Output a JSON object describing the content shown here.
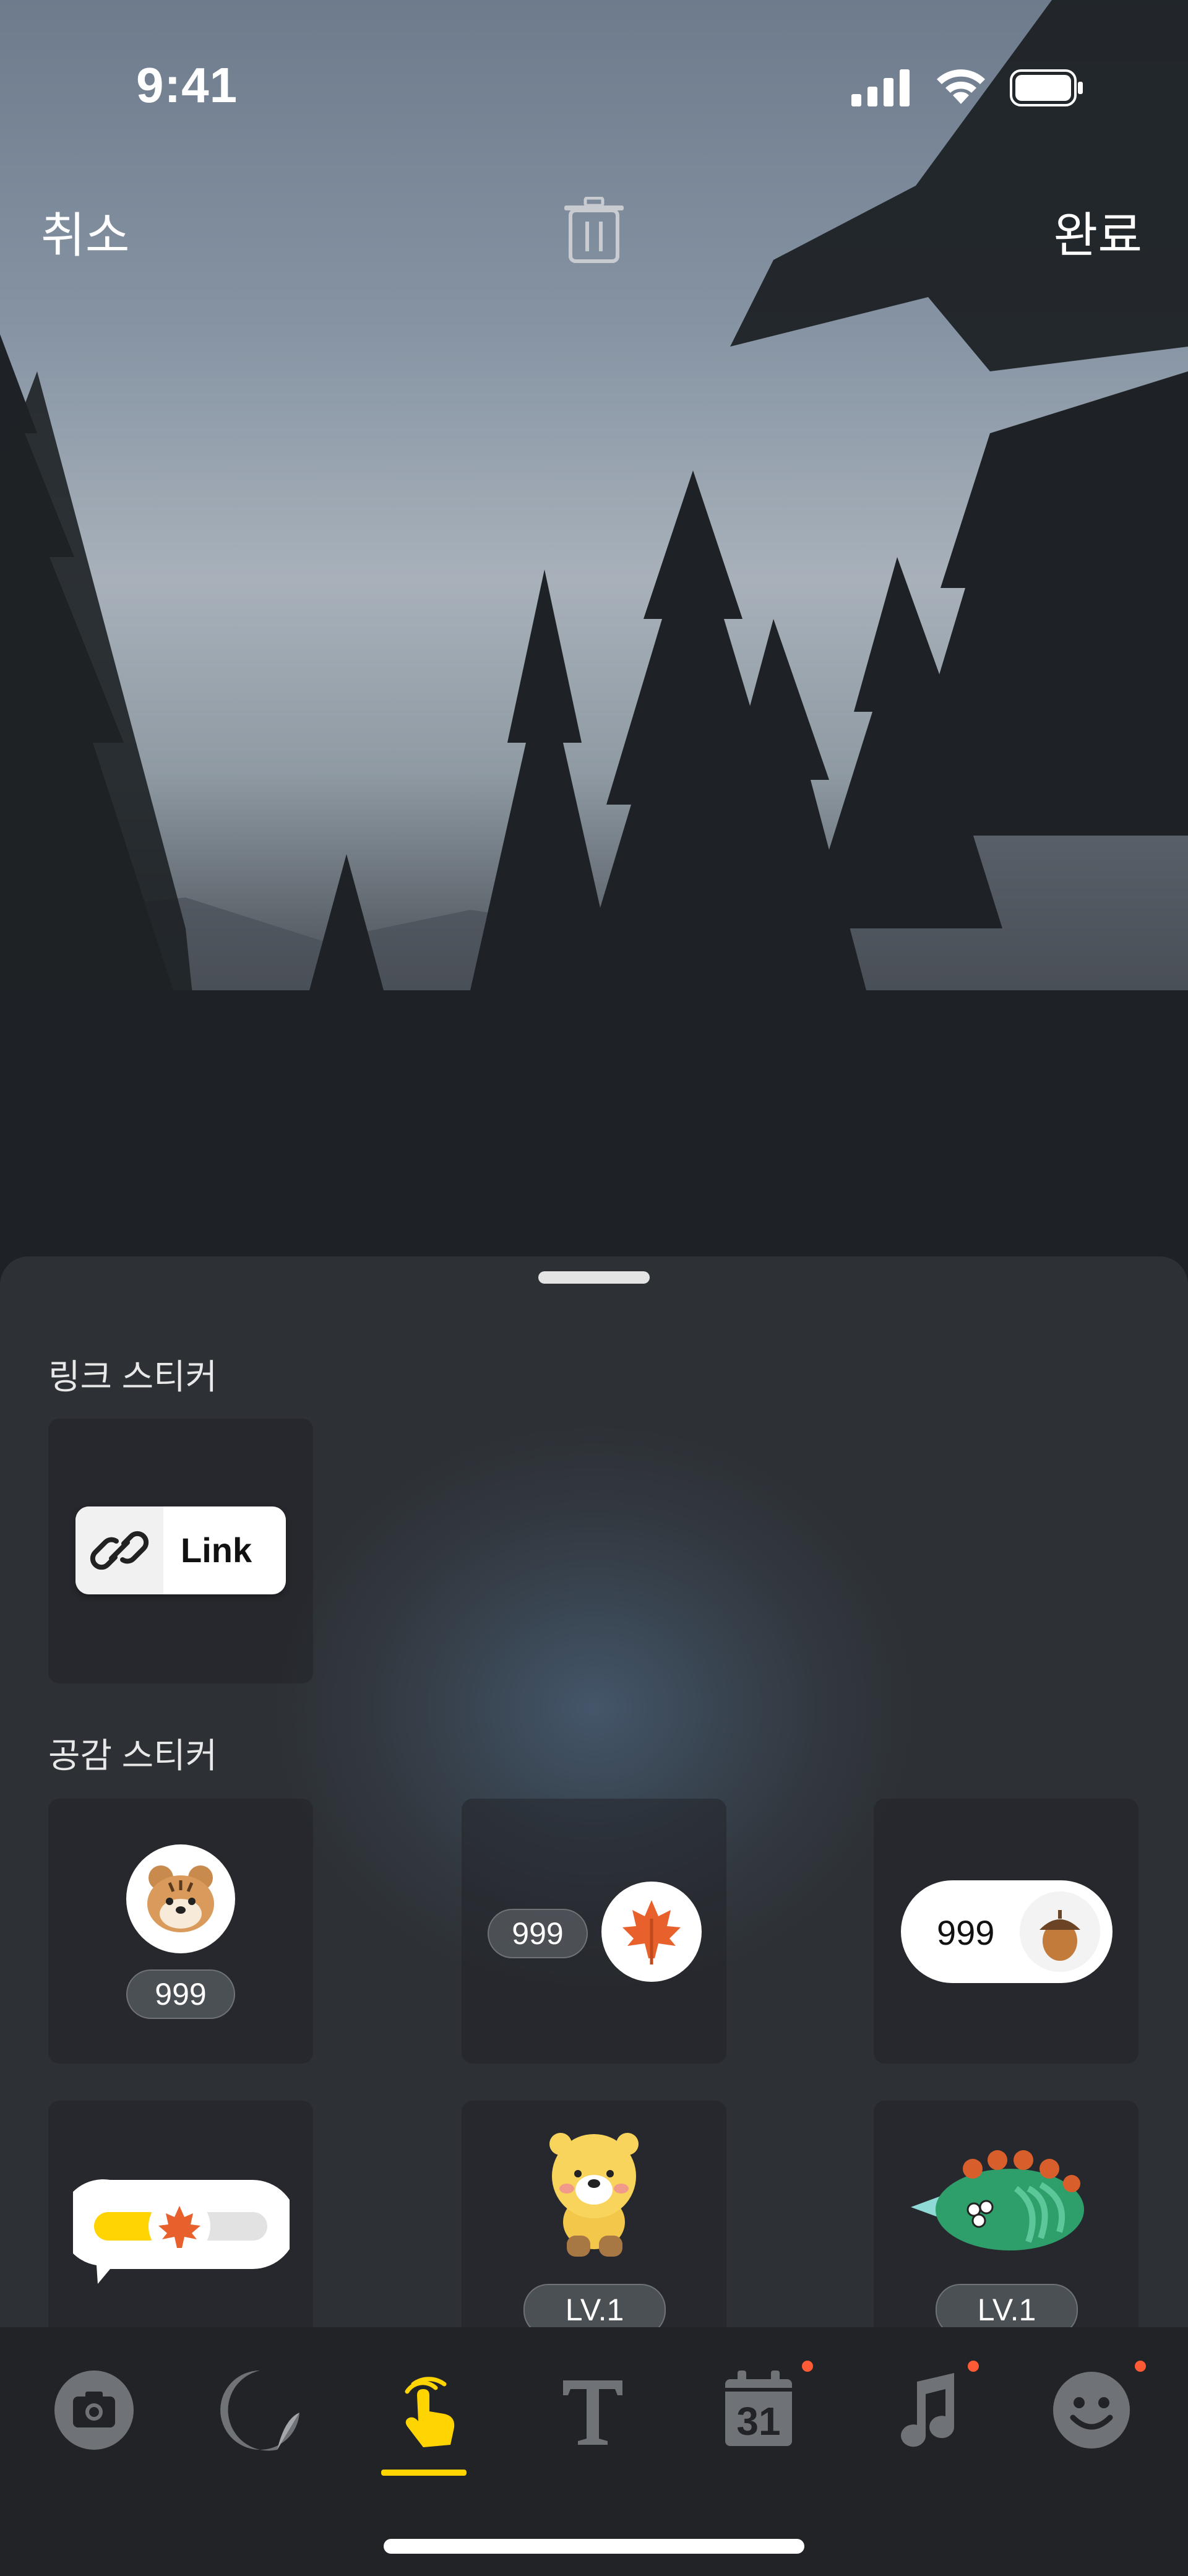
{
  "status_bar": {
    "time": "9:41"
  },
  "header": {
    "cancel": "취소",
    "done": "완료"
  },
  "sheet": {
    "link_section_title": "링크 스티커",
    "link_sticker_label": "Link",
    "reaction_section_title": "공감 스티커",
    "reaction_counts": [
      "999",
      "999",
      "999"
    ],
    "levels": [
      "LV.1",
      "LV.1"
    ]
  },
  "tabs": [
    {
      "name": "camera"
    },
    {
      "name": "sticker"
    },
    {
      "name": "interactive"
    },
    {
      "name": "text"
    },
    {
      "name": "calendar",
      "label": "31"
    },
    {
      "name": "music"
    },
    {
      "name": "emoji"
    }
  ],
  "colors": {
    "accent": "#ffd400",
    "badge": "#ff5a36"
  }
}
